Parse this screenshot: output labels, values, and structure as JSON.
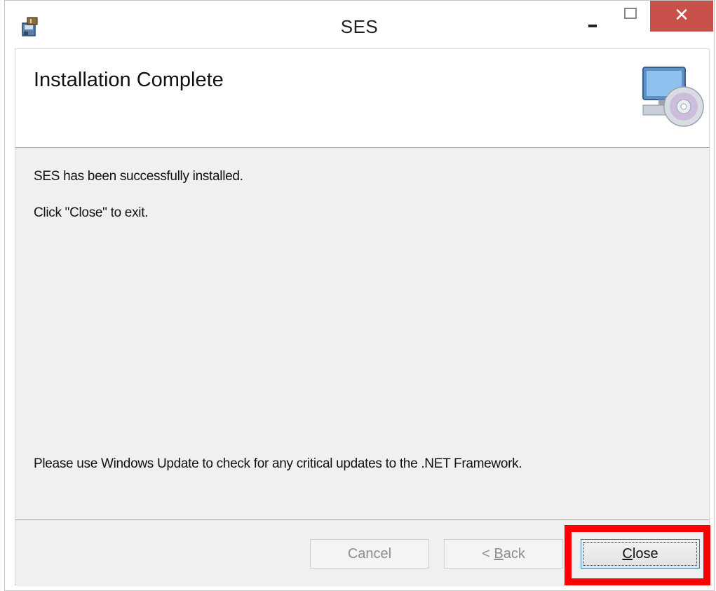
{
  "window": {
    "title": "SES",
    "title_close_glyph": "✕",
    "app_icon": "installer-icon"
  },
  "banner": {
    "title": "Installation Complete",
    "icon": "computer-cd-icon"
  },
  "body": {
    "line1": "SES has been successfully installed.",
    "line2": "Click \"Close\" to exit.",
    "line3": "Please use Windows Update to check for any critical updates to the .NET Framework."
  },
  "buttons": {
    "cancel": "Cancel",
    "back_prefix": "< ",
    "back_mnemonic": "B",
    "back_rest": "ack",
    "close_mnemonic": "C",
    "close_rest": "lose"
  },
  "colors": {
    "highlight": "#ff0000",
    "title_close_bg": "#c7504a",
    "panel_bg": "#f0f0f0"
  }
}
